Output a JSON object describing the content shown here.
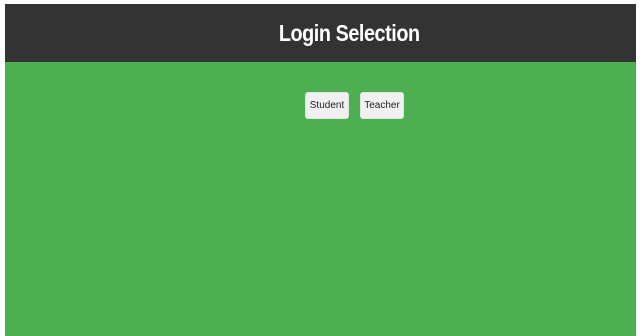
{
  "header": {
    "title": "Login Selection"
  },
  "login_options": {
    "student_label": "Student",
    "teacher_label": "Teacher"
  },
  "colors": {
    "header_background": "#333333",
    "page_background": "#4caf50",
    "button_background": "#f1f1f1"
  }
}
